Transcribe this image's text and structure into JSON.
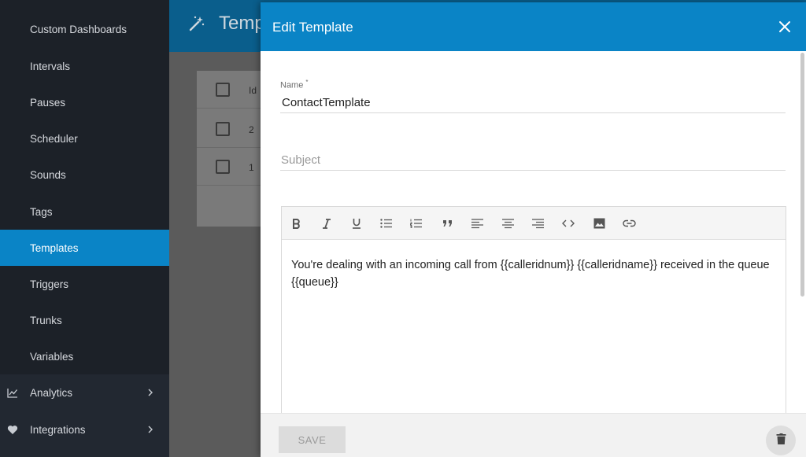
{
  "sidebar": {
    "items": [
      {
        "label": "Custom Dashboards"
      },
      {
        "label": "Intervals"
      },
      {
        "label": "Pauses"
      },
      {
        "label": "Scheduler"
      },
      {
        "label": "Sounds"
      },
      {
        "label": "Tags"
      },
      {
        "label": "Templates",
        "active": true
      },
      {
        "label": "Triggers"
      },
      {
        "label": "Trunks"
      },
      {
        "label": "Variables"
      },
      {
        "label": "Analytics",
        "icon": "chart-line-icon",
        "expandable": true
      },
      {
        "label": "Integrations",
        "icon": "heart-icon",
        "expandable": true
      }
    ]
  },
  "background_page": {
    "title": "Temp",
    "title_icon": "magic-wand-icon",
    "table": {
      "header": "Id",
      "rows": [
        "2",
        "1"
      ]
    }
  },
  "dialog": {
    "title": "Edit Template",
    "name_label": "Name",
    "name_required_mark": "*",
    "name_value": "ContactTemplate",
    "subject_placeholder": "Subject",
    "subject_value": "",
    "toolbar": [
      "bold-icon",
      "italic-icon",
      "underline-icon",
      "bullet-list-icon",
      "numbered-list-icon",
      "quote-icon",
      "align-left-icon",
      "align-center-icon",
      "align-right-icon",
      "code-icon",
      "image-icon",
      "link-icon"
    ],
    "body": "You're dealing with an incoming call from {{calleridnum}} {{calleridname}} received in the queue {{queue}}",
    "save_label": "SAVE",
    "delete_icon": "trash-icon"
  },
  "colors": {
    "accent": "#0a84c6",
    "sidebar": "#222831"
  }
}
